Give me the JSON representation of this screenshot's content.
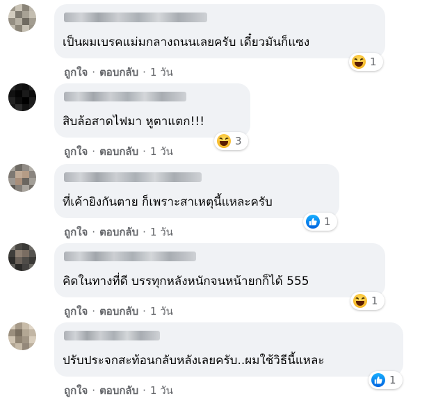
{
  "comments": [
    {
      "text": "เป็นผมเบรคแม่มกลางถนนเลยครับ เดี๋ยวมันก็แซง",
      "reaction": {
        "icon": "haha-icon",
        "count": "1"
      },
      "like_label": "ถูกใจ",
      "reply_label": "ตอบกลับ",
      "time": "1 วัน"
    },
    {
      "text": "สิบล้อสาดไฟมา หูตาแตก!!!",
      "reaction": {
        "icon": "haha-icon",
        "count": "3"
      },
      "like_label": "ถูกใจ",
      "reply_label": "ตอบกลับ",
      "time": "1 วัน"
    },
    {
      "text": "ที่เค้ายิงกันตาย ก็เพราะสาเหตุนี้แหละครับ",
      "reaction": {
        "icon": "like-icon",
        "count": "1"
      },
      "like_label": "ถูกใจ",
      "reply_label": "ตอบกลับ",
      "time": "1 วัน"
    },
    {
      "text": "คิดในทางที่ดี บรรทุกหลังหนักจนหน้ายกก็ได้ 555",
      "reaction": {
        "icon": "haha-icon",
        "count": "1"
      },
      "like_label": "ถูกใจ",
      "reply_label": "ตอบกลับ",
      "time": "1 วัน"
    },
    {
      "text": "ปรับประจกสะท้อนกลับหลังเลยครับ..ผมใช้วิธีนี้แหละ",
      "reaction": {
        "icon": "like-icon",
        "count": "1"
      },
      "like_label": "ถูกใจ",
      "reply_label": "ตอบกลับ",
      "time": "1 วัน"
    }
  ],
  "colors": {
    "bubble": "#f0f2f5",
    "meta_text": "#65676b",
    "like_blue": "#1877f2",
    "haha_yellow": "#f7b928"
  }
}
